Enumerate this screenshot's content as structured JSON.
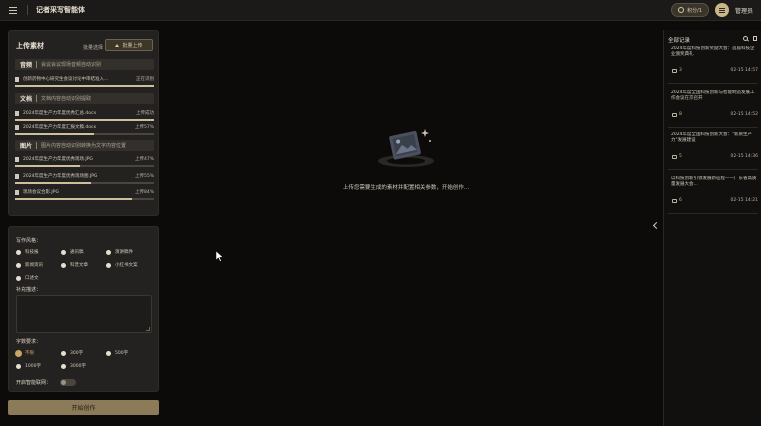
{
  "app": {
    "title": "记者采写智能体"
  },
  "header": {
    "credits": "积分/1",
    "user_name": "管理员"
  },
  "upload": {
    "title": "上传素材",
    "batch_label": "批量选择",
    "upload_button": "批量上传",
    "categories": [
      {
        "name": "音频",
        "desc": "会议会议现场音频自动识别",
        "files": [
          {
            "name": "创新药物中心研究生会议讨论中审结准入...",
            "status": "正在识别",
            "progress": 1.0
          }
        ]
      },
      {
        "name": "文档",
        "desc": "文档内容自动识别提取",
        "files": [
          {
            "name": "2024年度生产力年度优秀汇总.docx",
            "status": "上传成功",
            "progress": 1.0
          },
          {
            "name": "2024年度生产力年度汇报文稿.docx",
            "status": "上传57%",
            "progress": 0.57
          }
        ]
      },
      {
        "name": "图片",
        "desc": "图片内容自动识别转换为文字内容位置",
        "files": [
          {
            "name": "2024年度生产力年度优秀现场.JPG",
            "status": "上传47%",
            "progress": 0.47
          },
          {
            "name": "2024年度生产力年度优秀现场图.JPG",
            "status": "上传55%",
            "progress": 0.55
          },
          {
            "name": "现场会议合影.JPG",
            "status": "上传84%",
            "progress": 0.84
          }
        ]
      }
    ]
  },
  "settings": {
    "style_label": "写作风格：",
    "styles": [
      "科技报",
      "通讯稿",
      "演讲稿件",
      "新闻资讯",
      "科普文章",
      "小红书文案",
      "口述文"
    ],
    "notes_label": "补充描述：",
    "length_label": "字数要求：",
    "lengths": [
      "不限",
      "300字",
      "500字",
      "1000字",
      "3000字"
    ],
    "selected_length": "不限",
    "smart_label": "开启智能联网：",
    "start_button": "开始创作"
  },
  "main": {
    "empty_text": "上传您需要生成的素材并配置相关参数，开始创作..."
  },
  "records": {
    "title": "全部记录",
    "items": [
      {
        "title": "2024年度科技创新奖励大会：首届科技企业颁奖典礼",
        "count": "3",
        "time": "02-15 14:57"
      },
      {
        "title": "2024年度全国科技创新与智能制造发展工作会议在京召开",
        "count": "8",
        "time": "02-15 14:52"
      },
      {
        "title": "2024年度全国科技创新大会：\"新质生产力\"发展建设",
        "count": "5",
        "time": "02-15 14:36"
      },
      {
        "title": "以科技创新引领发展新征程——广东省高质量发展大会...",
        "count": "6",
        "time": "02-15 14:21"
      }
    ]
  }
}
